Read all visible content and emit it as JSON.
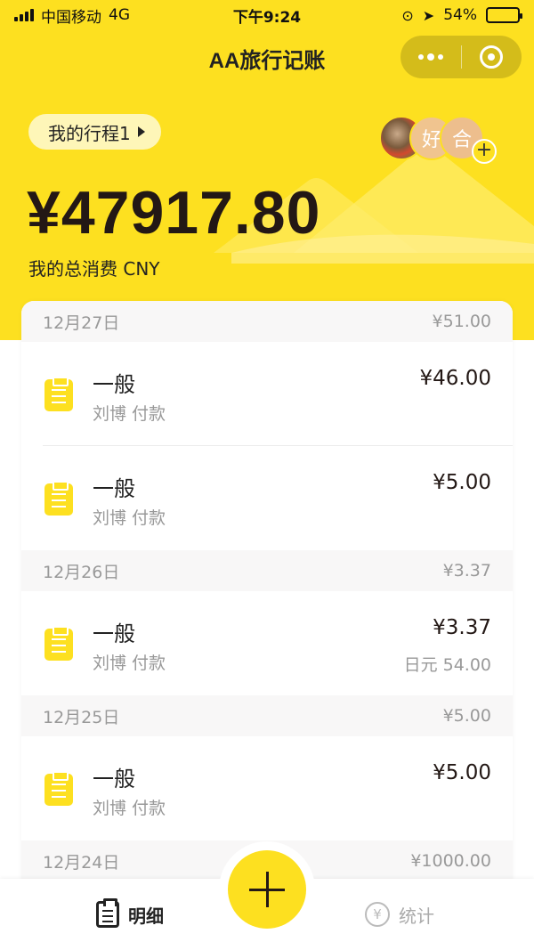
{
  "status_bar": {
    "carrier": "中国移动",
    "network": "4G",
    "time": "下午9:24",
    "battery": "54%",
    "battery_level": 0.54
  },
  "header": {
    "title": "AA旅行记账",
    "trip_name": "我的行程1",
    "total_amount": "¥47917.80",
    "total_label": "我的总消费 CNY",
    "members": [
      {
        "label": ""
      },
      {
        "label": "好"
      },
      {
        "label": "合"
      }
    ],
    "add_member_label": "+"
  },
  "days": [
    {
      "date": "12月27日",
      "total": "¥51.00",
      "entries": [
        {
          "category": "一般",
          "payer": "刘博 付款",
          "amount": "¥46.00",
          "original_amount": ""
        },
        {
          "category": "一般",
          "payer": "刘博 付款",
          "amount": "¥5.00",
          "original_amount": ""
        }
      ]
    },
    {
      "date": "12月26日",
      "total": "¥3.37",
      "entries": [
        {
          "category": "一般",
          "payer": "刘博 付款",
          "amount": "¥3.37",
          "original_amount": "日元 54.00"
        }
      ]
    },
    {
      "date": "12月25日",
      "total": "¥5.00",
      "entries": [
        {
          "category": "一般",
          "payer": "刘博 付款",
          "amount": "¥5.00",
          "original_amount": ""
        }
      ]
    },
    {
      "date": "12月24日",
      "total": "¥1000.00",
      "entries": []
    }
  ],
  "tabbar": {
    "detail_label": "明细",
    "stats_label": "统计",
    "yen_symbol": "¥"
  },
  "colors": {
    "brand_yellow": "#FDE020",
    "pill_bg": "#FEF6B8",
    "text_dark": "#231815",
    "text_muted": "#999999"
  }
}
